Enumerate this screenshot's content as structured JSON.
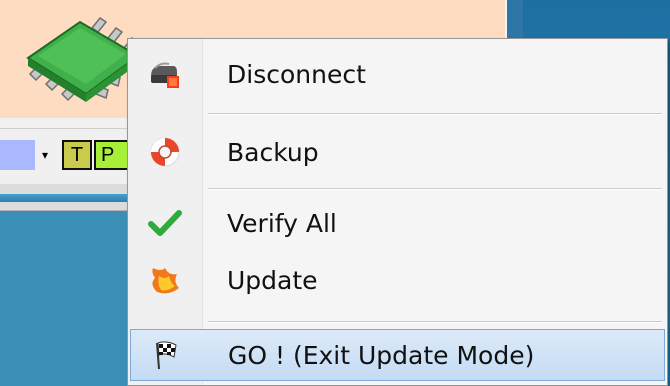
{
  "toolbar": {
    "btn_t_label": "T",
    "btn_p_label": "P",
    "dropdown_arrow": "▾"
  },
  "context_menu": {
    "items": [
      {
        "label": "Disconnect",
        "icon": "disconnect-icon"
      },
      {
        "label": "Backup",
        "icon": "lifebuoy-icon"
      },
      {
        "label": "Verify All",
        "icon": "checkmark-icon"
      },
      {
        "label": "Update",
        "icon": "flame-icon"
      },
      {
        "label": "GO ! (Exit Update Mode)",
        "icon": "checkered-flag-icon",
        "highlighted": true
      }
    ]
  },
  "colors": {
    "menu_highlight": "#c4dbf4",
    "desktop": "#3b8fb6",
    "panel": "#fddcc2",
    "chip_green": "#3fb04a"
  }
}
